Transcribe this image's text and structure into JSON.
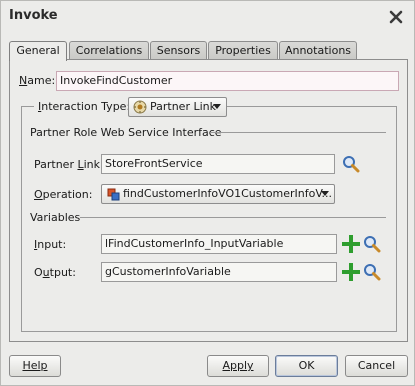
{
  "dialog": {
    "title": "Invoke"
  },
  "tabs": [
    {
      "label": "General",
      "active": true
    },
    {
      "label": "Correlations",
      "active": false
    },
    {
      "label": "Sensors",
      "active": false
    },
    {
      "label": "Properties",
      "active": false
    },
    {
      "label": "Annotations",
      "active": false
    }
  ],
  "name": {
    "label": "Name:",
    "value": "InvokeFindCustomer"
  },
  "interaction": {
    "label": "Interaction Type:",
    "value": "Partner Link",
    "icon": "partner-link-icon"
  },
  "partner_role": {
    "heading": "Partner Role Web Service Interface",
    "partner_link_label": "Partner Link:",
    "partner_link_value": "StoreFrontService",
    "operation_label": "Operation:",
    "operation_value": "findCustomerInfoVO1CustomerInfoV..."
  },
  "variables": {
    "heading": "Variables",
    "input_label": "Input:",
    "input_value": "lFindCustomerInfo_InputVariable",
    "output_label": "Output:",
    "output_value": "gCustomerInfoVariable"
  },
  "buttons": {
    "help": "Help",
    "apply": "Apply",
    "ok": "OK",
    "cancel": "Cancel"
  },
  "colors": {
    "accent_green": "#2e9e2e",
    "search_blue": "#3d6fb3"
  }
}
